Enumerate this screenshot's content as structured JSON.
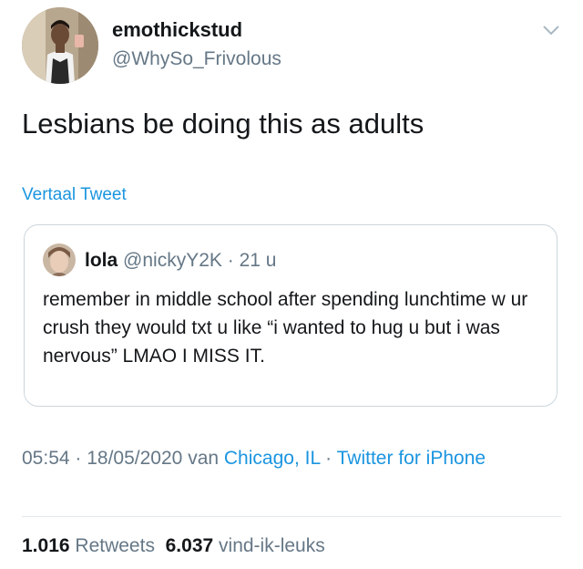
{
  "author": {
    "display_name": "emothickstud",
    "handle": "@WhySo_Frivolous"
  },
  "tweet": {
    "text": "Lesbians be doing this as adults",
    "translate_label": "Vertaal Tweet"
  },
  "quoted": {
    "name": "lola",
    "handle": "@nickyY2K",
    "separator": " · ",
    "time": "21 u",
    "text": "remember in middle school after spending lunchtime w ur crush they would txt u like “i wanted to hug u but i was nervous” LMAO I MISS IT."
  },
  "meta": {
    "time": "05:54",
    "sep1": " · ",
    "date": "18/05/2020",
    "from_word": "van",
    "location": "Chicago, IL",
    "sep2": " · ",
    "source": "Twitter for iPhone"
  },
  "stats": {
    "retweets_count": "1.016",
    "retweets_label": "Retweets",
    "likes_count": "6.037",
    "likes_label": "vind-ik-leuks"
  },
  "icons": {
    "menu": "chevron-down-icon"
  },
  "colors": {
    "link": "#1b95e0",
    "secondary_text": "#657786",
    "primary_text": "#14171a",
    "border": "#ccd6dd"
  }
}
